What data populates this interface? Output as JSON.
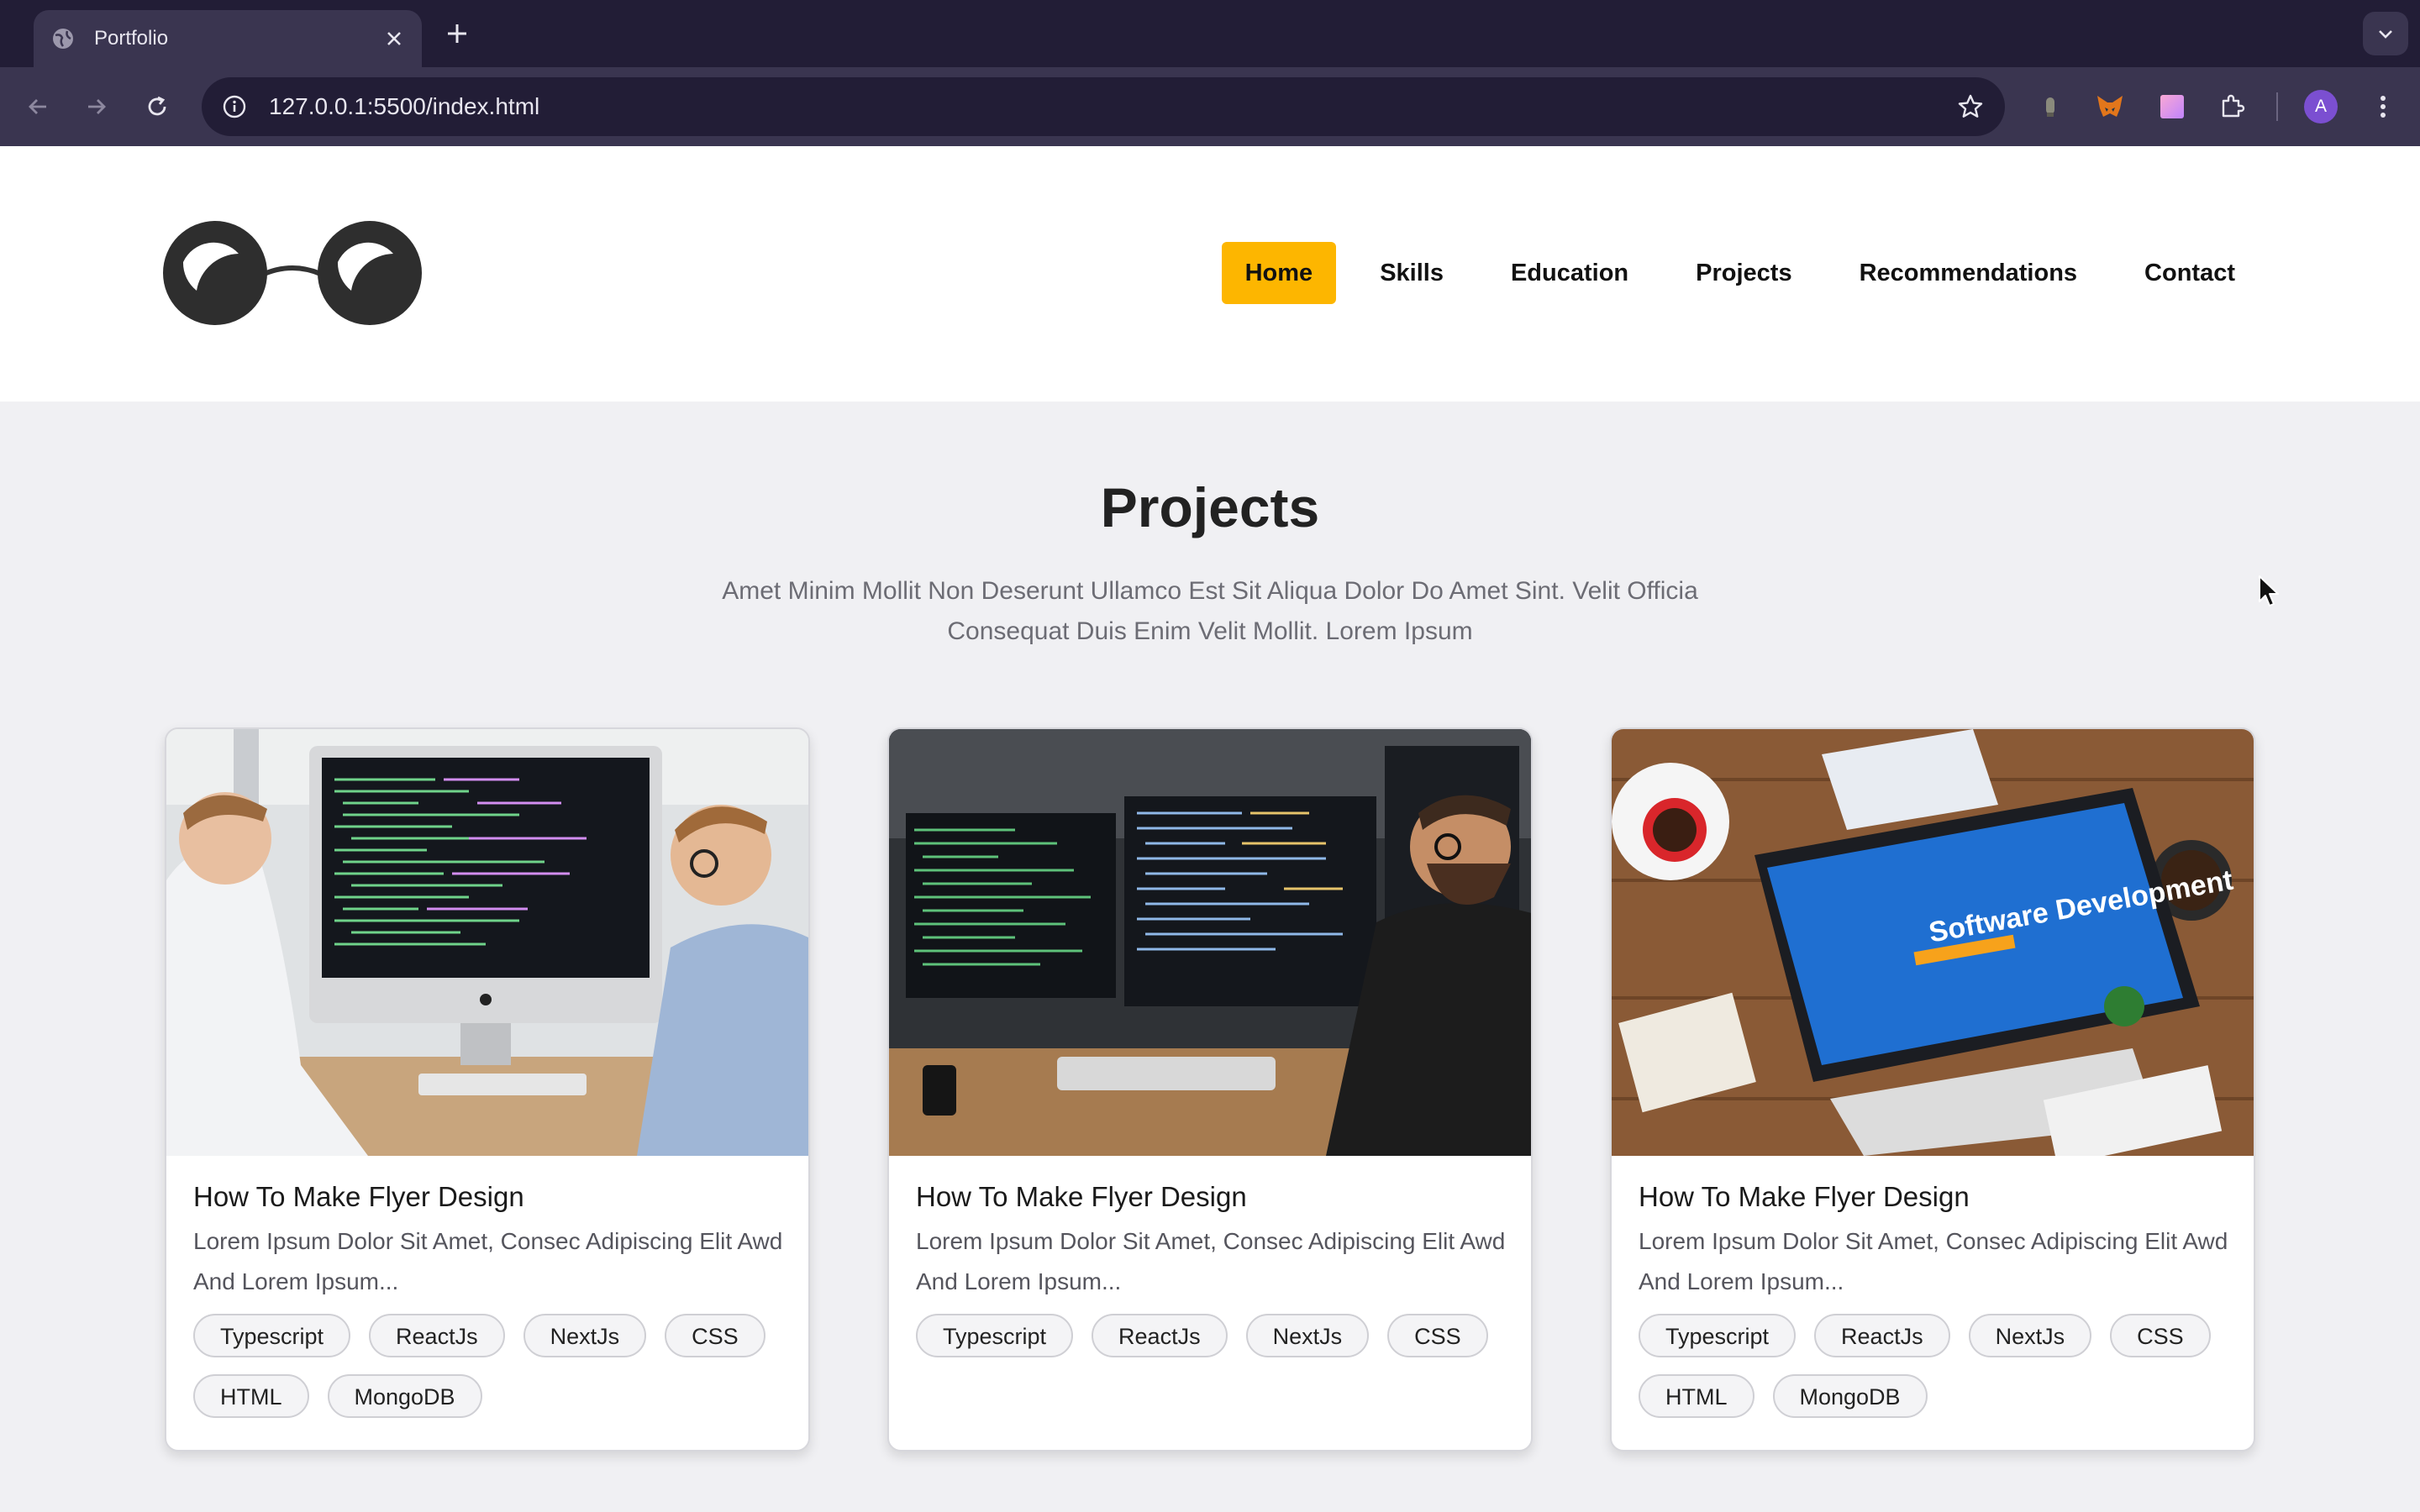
{
  "browser": {
    "tab_title": "Portfolio",
    "url": "127.0.0.1:5500/index.html",
    "profile_initial": "A",
    "accent": "#221d36"
  },
  "site": {
    "logo": "sunglasses-logo",
    "nav": [
      {
        "label": "Home",
        "active": true
      },
      {
        "label": "Skills",
        "active": false
      },
      {
        "label": "Education",
        "active": false
      },
      {
        "label": "Projects",
        "active": false
      },
      {
        "label": "Recommendations",
        "active": false
      },
      {
        "label": "Contact",
        "active": false
      }
    ],
    "active_color": "#fdb600"
  },
  "projects": {
    "title": "Projects",
    "subtitle": "Amet Minim Mollit Non Deserunt Ullamco Est Sit Aliqua Dolor Do Amet Sint. Velit Officia Consequat Duis Enim Velit Mollit. Lorem Ipsum",
    "cards": [
      {
        "image": "two-developers-at-imac-photo",
        "title": "How To Make Flyer Design",
        "description": "Lorem Ipsum Dolor Sit Amet, Consec Adipiscing Elit Awd And Lorem Ipsum...",
        "tags": [
          "Typescript",
          "ReactJs",
          "NextJs",
          "CSS",
          "HTML",
          "MongoDB"
        ]
      },
      {
        "image": "developer-dual-monitors-photo",
        "title": "How To Make Flyer Design",
        "description": "Lorem Ipsum Dolor Sit Amet, Consec Adipiscing Elit Awd And Lorem Ipsum...",
        "tags": [
          "Typescript",
          "ReactJs",
          "NextJs",
          "CSS"
        ]
      },
      {
        "image": "software-development-desk-photo",
        "image_text": "Software Development",
        "title": "How To Make Flyer Design",
        "description": "Lorem Ipsum Dolor Sit Amet, Consec Adipiscing Elit Awd And Lorem Ipsum...",
        "tags": [
          "Typescript",
          "ReactJs",
          "NextJs",
          "CSS",
          "HTML",
          "MongoDB"
        ]
      }
    ]
  }
}
